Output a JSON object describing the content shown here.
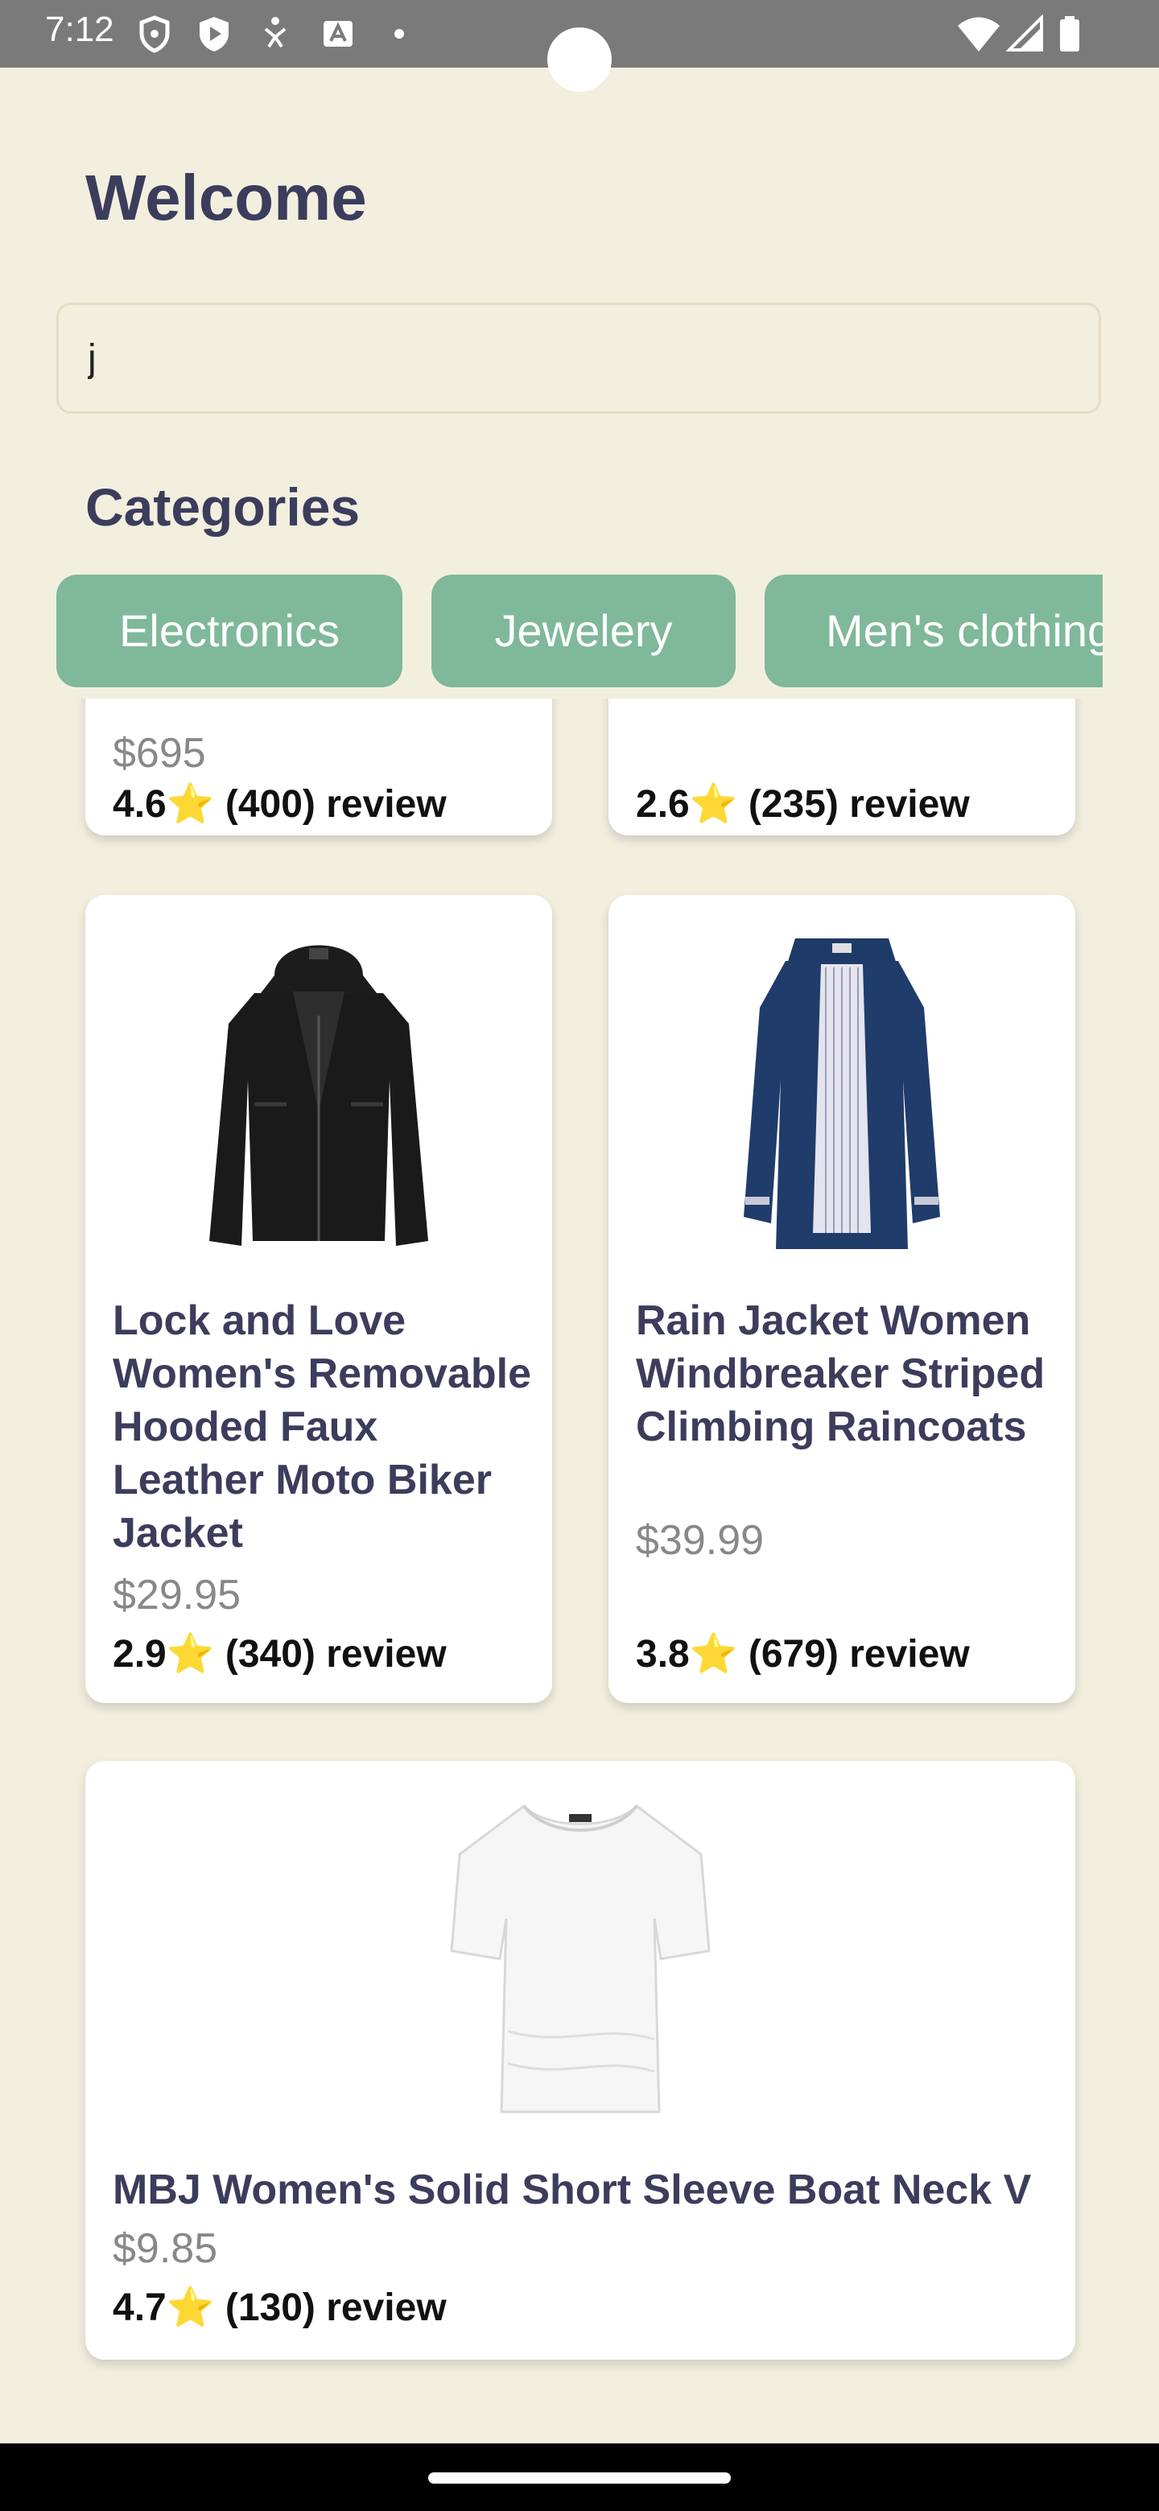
{
  "status_bar": {
    "time": "7:12",
    "left_icons": [
      "shield-icon",
      "play-protect-icon",
      "accessibility-icon",
      "autofill-icon",
      "dot-icon"
    ],
    "right_icons": [
      "wifi-icon",
      "signal-icon",
      "battery-icon"
    ]
  },
  "header": {
    "title": "Welcome"
  },
  "search": {
    "value": "j"
  },
  "categories": {
    "title": "Categories",
    "items": [
      "Electronics",
      "Jewelery",
      "Men's clothing"
    ]
  },
  "products": [
    {
      "price": "$695",
      "rating": "4.6",
      "reviews": "(400) review"
    },
    {
      "rating": "2.6",
      "reviews": "(235) review"
    },
    {
      "name": "Lock and Love Women's Removable Hooded Faux Leather Moto Biker Jacket",
      "price": "$29.95",
      "rating": "2.9",
      "reviews": "(340) review",
      "image": "black-leather-jacket"
    },
    {
      "name": "Rain Jacket Women Windbreaker Striped Climbing Raincoats",
      "price": "$39.99",
      "rating": "3.8",
      "reviews": "(679) review",
      "image": "navy-rain-jacket"
    },
    {
      "name": "MBJ Women's Solid Short Sleeve Boat Neck V",
      "price": "$9.85",
      "rating": "4.7",
      "reviews": "(130) review",
      "image": "white-tshirt"
    }
  ],
  "star": "⭐",
  "colors": {
    "background": "#f2efdf",
    "chip": "#7fb89a",
    "title": "#3c3d5c",
    "price": "#888888",
    "status_bar": "#7a7a7a"
  }
}
